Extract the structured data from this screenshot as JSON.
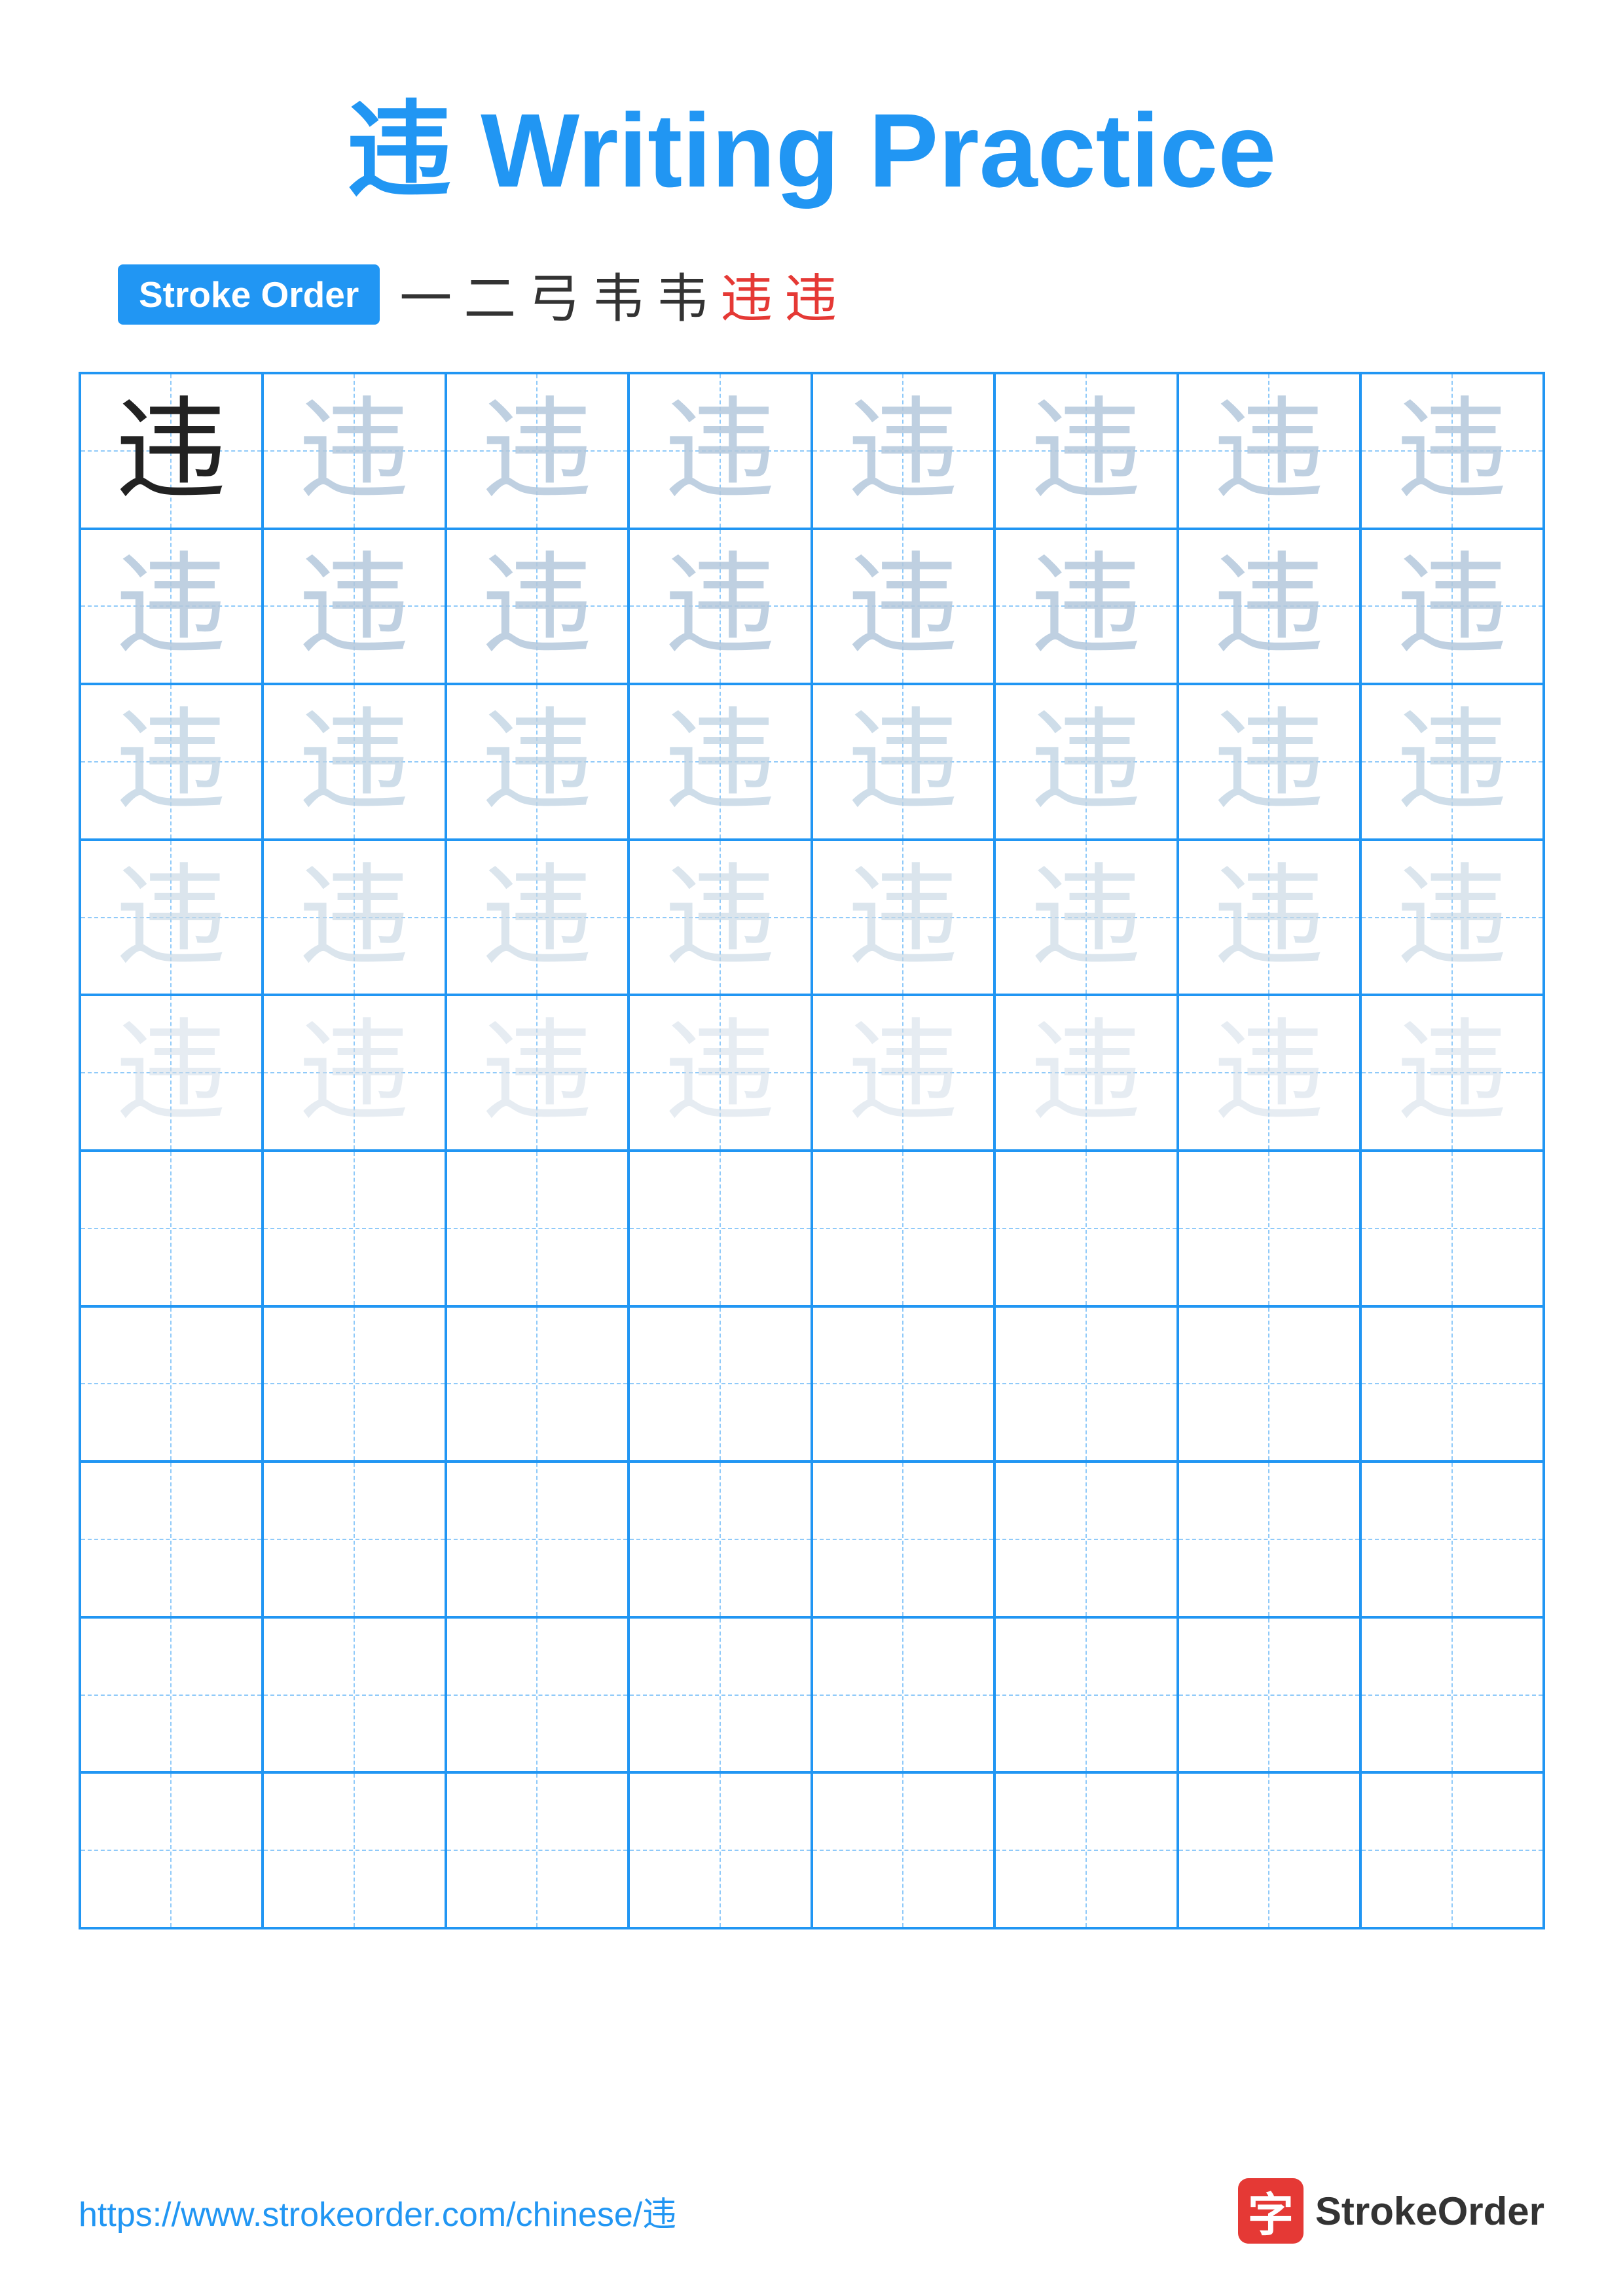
{
  "title": "违 Writing Practice",
  "stroke_order": {
    "badge_label": "Stroke Order",
    "strokes": [
      "一",
      "二",
      "弓",
      "韦",
      "韦",
      "违",
      "违"
    ],
    "stroke_colors": [
      "dark",
      "dark",
      "dark",
      "dark",
      "dark",
      "red",
      "red"
    ]
  },
  "character": "违",
  "grid": {
    "cols": 8,
    "rows": 10,
    "filled_rows": 5,
    "char_shades": [
      "dark",
      "light1",
      "light1",
      "light1",
      "light1",
      "light2",
      "light2",
      "light2",
      "light1",
      "light1",
      "light1",
      "light1",
      "light1",
      "light2",
      "light2",
      "light2",
      "light2",
      "light2",
      "light2",
      "light2",
      "light2",
      "light3",
      "light3",
      "light3",
      "light3",
      "light3",
      "light3",
      "light3",
      "light3",
      "light4",
      "light4",
      "light4",
      "light4",
      "light4",
      "light4",
      "light4",
      "light4",
      "light4",
      "light4",
      "light4",
      "light4"
    ]
  },
  "footer": {
    "url": "https://www.strokeorder.com/chinese/违",
    "logo_char": "字",
    "logo_text": "StrokeOrder"
  }
}
